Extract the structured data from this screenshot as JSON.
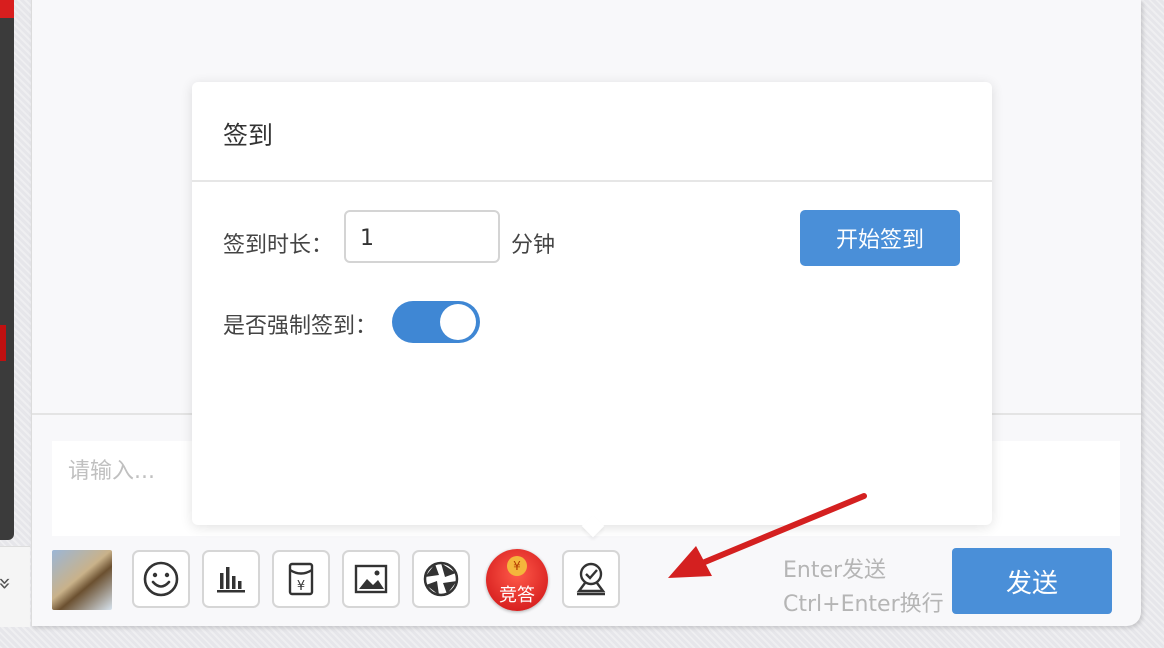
{
  "modal": {
    "title": "签到",
    "duration_label": "签到时长：",
    "duration_value": "1",
    "duration_unit": "分钟",
    "start_button": "开始签到",
    "force_label": "是否强制签到：",
    "force_enabled": true
  },
  "composer": {
    "placeholder": "请输入...",
    "send_hint_1": "Enter发送",
    "send_hint_2": "Ctrl+Enter换行",
    "send_button": "发送"
  },
  "toolbar": {
    "contest_label": "竞答",
    "contest_coin": "¥",
    "tools": [
      "emoji-icon",
      "bar-chart-icon",
      "red-packet-icon",
      "image-icon",
      "aperture-icon",
      "contest-icon",
      "check-in-icon"
    ]
  },
  "colors": {
    "primary": "#4a8fd8",
    "toggle_on": "#3f87d4",
    "contest_red": "#d61e1e",
    "annotation_arrow": "#d42020"
  }
}
